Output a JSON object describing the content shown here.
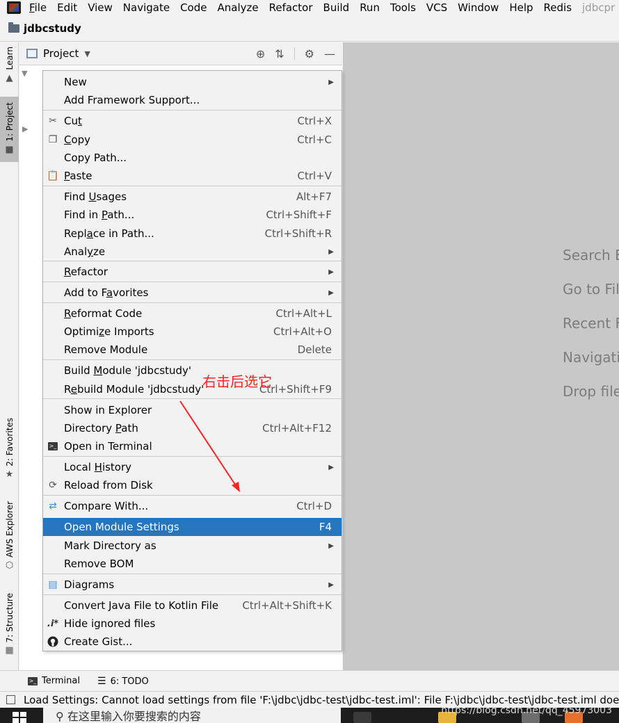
{
  "menubar": {
    "items": [
      "File",
      "Edit",
      "View",
      "Navigate",
      "Code",
      "Analyze",
      "Refactor",
      "Build",
      "Run",
      "Tools",
      "VCS",
      "Window",
      "Help",
      "Redis"
    ],
    "overflow": "jdbcpr"
  },
  "navbar": {
    "project": "jdbcstudy"
  },
  "leftstrip": {
    "learn": "Learn",
    "project": "1: Project",
    "favorites": "2: Favorites",
    "aws": "AWS Explorer",
    "structure": "7: Structure"
  },
  "project_panel": {
    "title": "Project"
  },
  "editor_hints": [
    "Search E",
    "Go to Fil",
    "Recent F",
    "Navigatio",
    "Drop file"
  ],
  "context_menu": {
    "new": {
      "label": "New"
    },
    "add_framework": {
      "label": "Add Framework Support..."
    },
    "cut": {
      "label": "Cut",
      "shortcut": "Ctrl+X"
    },
    "copy": {
      "label": "Copy",
      "shortcut": "Ctrl+C"
    },
    "copy_path": {
      "label": "Copy Path..."
    },
    "paste": {
      "label": "Paste",
      "shortcut": "Ctrl+V"
    },
    "find_usages": {
      "label": "Find Usages",
      "shortcut": "Alt+F7"
    },
    "find_in_path": {
      "label": "Find in Path...",
      "shortcut": "Ctrl+Shift+F"
    },
    "replace_in_path": {
      "label": "Replace in Path...",
      "shortcut": "Ctrl+Shift+R"
    },
    "analyze": {
      "label": "Analyze"
    },
    "refactor": {
      "label": "Refactor"
    },
    "add_to_favorites": {
      "label": "Add to Favorites"
    },
    "reformat_code": {
      "label": "Reformat Code",
      "shortcut": "Ctrl+Alt+L"
    },
    "optimize_imports": {
      "label": "Optimize Imports",
      "shortcut": "Ctrl+Alt+O"
    },
    "remove_module": {
      "label": "Remove Module",
      "shortcut": "Delete"
    },
    "build_module": {
      "label": "Build Module 'jdbcstudy'"
    },
    "rebuild_module": {
      "label": "Rebuild Module 'jdbcstudy'",
      "shortcut": "Ctrl+Shift+F9"
    },
    "show_in_explorer": {
      "label": "Show in Explorer"
    },
    "directory_path": {
      "label": "Directory Path",
      "shortcut": "Ctrl+Alt+F12"
    },
    "open_in_terminal": {
      "label": "Open in Terminal"
    },
    "local_history": {
      "label": "Local History"
    },
    "reload_from_disk": {
      "label": "Reload from Disk"
    },
    "compare_with": {
      "label": "Compare With...",
      "shortcut": "Ctrl+D"
    },
    "open_module_settings": {
      "label": "Open Module Settings",
      "shortcut": "F4"
    },
    "mark_directory_as": {
      "label": "Mark Directory as"
    },
    "remove_bom": {
      "label": "Remove BOM"
    },
    "diagrams": {
      "label": "Diagrams"
    },
    "convert_kotlin": {
      "label": "Convert Java File to Kotlin File",
      "shortcut": "Ctrl+Alt+Shift+K"
    },
    "hide_ignored": {
      "label": "Hide ignored files",
      "icon_text": ".i*"
    },
    "create_gist": {
      "label": "Create Gist..."
    }
  },
  "annotation": {
    "text": "右击后选它",
    "color": "#ff2222"
  },
  "bottombar": {
    "terminal": "Terminal",
    "todo": "6: TODO"
  },
  "statusbar": {
    "message": "Load Settings: Cannot load settings from file 'F:\\jdbc\\jdbc-test\\jdbc-test.iml': File F:\\jdbc\\jdbc-test\\jdbc-test.iml does"
  },
  "taskbar": {
    "search_placeholder": "在这里输入你要搜索的内容",
    "watermark": "https://blog.csdn.net/qq_45973003"
  },
  "colors": {
    "selection": "#2675bf",
    "editor_bg": "#c8c8c8",
    "annotation": "#ff2222"
  }
}
